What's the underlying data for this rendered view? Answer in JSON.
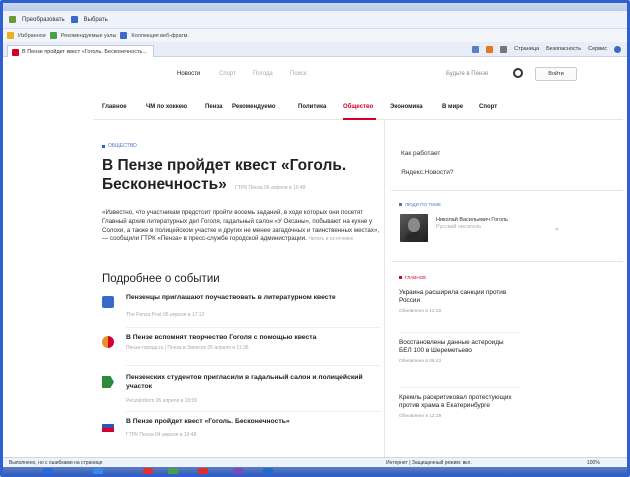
{
  "browser": {
    "menubar": [
      "Преобразовать",
      "Выбрать"
    ],
    "favorites": [
      "Избранное",
      "Рекомендуемые узлы",
      "Коллекция веб-фрагм."
    ],
    "tab_title": "В Пензе пройдет квест «Гоголь. Бесконечность...",
    "tools": [
      "Страница",
      "Безопасность",
      "Сервис"
    ],
    "status_left": "Выполнено, но с ошибками на странице",
    "status_mid": "Интернет | Защищенный режим: вкл.",
    "status_zoom": "100%"
  },
  "site": {
    "topnav": [
      {
        "label": "Новости",
        "active": true
      },
      {
        "label": "Спорт",
        "active": false
      },
      {
        "label": "Погода",
        "active": false
      },
      {
        "label": "Поиск",
        "active": false
      }
    ],
    "be_first": "Будьте в Пензе",
    "login": "Войти",
    "rubrics": [
      {
        "label": "Главное",
        "active": false
      },
      {
        "label": "ЧМ по хоккею",
        "active": false
      },
      {
        "label": "Пенза",
        "active": false
      },
      {
        "label": "Рекомендуемо",
        "active": false
      },
      {
        "label": "Политика",
        "active": false
      },
      {
        "label": "Общество",
        "active": true
      },
      {
        "label": "Экономика",
        "active": false
      },
      {
        "label": "В мире",
        "active": false
      },
      {
        "label": "Спорт",
        "active": false
      }
    ]
  },
  "article": {
    "category": "ОБЩЕСТВО",
    "headline": "В Пензе пройдет квест «Гоголь. Бесконечность»",
    "source_date": "ГТРК Пенза 06 апреля в 10:48",
    "lead": "«Известно, что участникам предстоит пройти восемь заданий, в ходе которых они посетят Главный архив литературных дел Гоголя, гадальный салон «У Оксаны», побывают на кухне у Солохи, а также в полицейском участке и других не менее загадочных и таинственных местах», — сообщили ГТРК «Пенза» в пресс-службе городской администрации.",
    "lead_more": "Читать в источнике",
    "more_title": "Подробнее о событии",
    "related": [
      {
        "title": "Пензенцы приглашают поучаствовать в литературном квесте",
        "src": "The Penza Post 05 апреля в 17:12"
      },
      {
        "title": "В Пензе вспомнят творчество Гоголя с помощью квеста",
        "src": "Пенза-города.ru | Пенза в Записях 05 апреля в 11:36"
      },
      {
        "title": "Пензенских студентов пригласили в гадальный салон и полицейский участок",
        "src": "PenzaInform 05 апреля в 18:09"
      },
      {
        "title": "В Пензе пройдет квест «Гоголь. Бесконечность»",
        "src": "ГТРК Пенза 04 апреля в 10:48"
      }
    ]
  },
  "sidebar": {
    "links": [
      "Как работает",
      "Яндекс.Новости?"
    ],
    "person_cat": "ЛЮДИ ПО ТЕМЕ",
    "person_name": "Николай Васильевич Гоголь",
    "person_role": "Русский писатель",
    "main_cat": "ГЛАВНОЕ",
    "news": [
      {
        "title": "Украина расширила санкции против России",
        "time": "Обновлено в 12:32"
      },
      {
        "title": "Восстановлены данные астероиды БЕЛ 100 в Шереметьево",
        "time": "Обновлено в 08:42"
      },
      {
        "title": "Кремль раскритиковал протестующих против храма в Екатеринбурге",
        "time": "Обновлено в 12:39"
      }
    ]
  }
}
